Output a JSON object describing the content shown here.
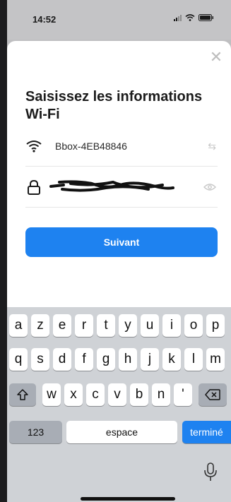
{
  "status_bar": {
    "time": "14:52"
  },
  "sheet": {
    "close_icon": "close-icon",
    "title": "Saisissez les informations Wi-Fi",
    "ssid": {
      "icon": "wifi-icon",
      "value": "Bbox-4EB48846",
      "action_icon": "swap-icon"
    },
    "password": {
      "icon": "lock-icon",
      "value_redacted": true,
      "action_icon": "eye-icon"
    },
    "next_button": "Suivant"
  },
  "keyboard": {
    "row1": [
      "a",
      "z",
      "e",
      "r",
      "t",
      "y",
      "u",
      "i",
      "o",
      "p"
    ],
    "row2": [
      "q",
      "s",
      "d",
      "f",
      "g",
      "h",
      "j",
      "k",
      "l",
      "m"
    ],
    "row3": [
      "w",
      "x",
      "c",
      "v",
      "b",
      "n",
      "'"
    ],
    "numbers_key": "123",
    "space_key": "espace",
    "done_key": "terminé"
  },
  "colors": {
    "accent": "#1e82f0",
    "sheet_bg": "#ffffff",
    "keyboard_bg": "#cfd2d6"
  }
}
